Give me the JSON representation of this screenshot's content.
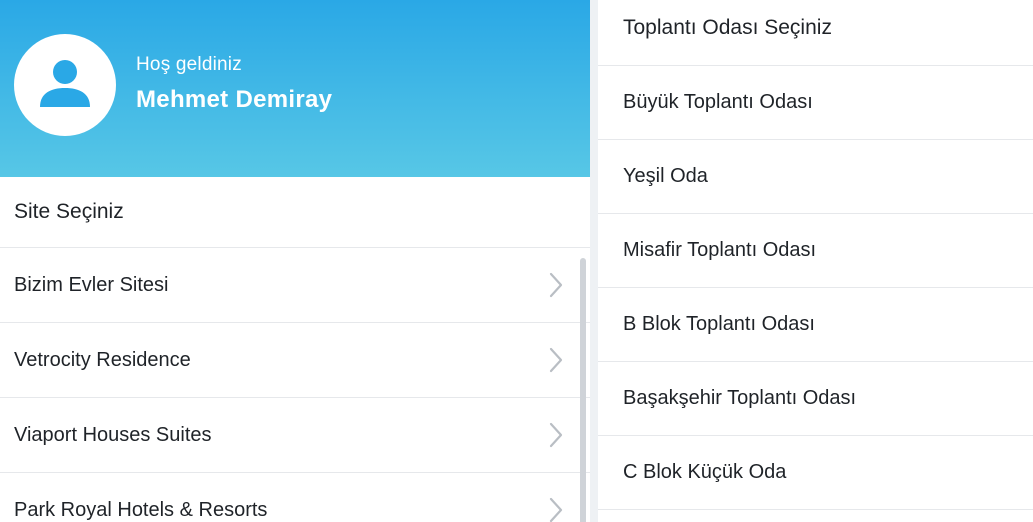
{
  "header": {
    "welcome": "Hoş geldiniz",
    "user_name": "Mehmet Demiray",
    "avatar_icon": "user-icon",
    "gradient_top": "#2aa8e6",
    "gradient_bottom": "#57c7e6"
  },
  "sites": {
    "title": "Site Seçiniz",
    "items": [
      {
        "label": "Bizim Evler Sitesi",
        "icon": "chevron-right-icon"
      },
      {
        "label": "Vetrocity Residence",
        "icon": "chevron-right-icon"
      },
      {
        "label": "Viaport Houses Suites",
        "icon": "chevron-right-icon"
      },
      {
        "label": "Park Royal Hotels & Resorts",
        "icon": "chevron-right-icon"
      }
    ]
  },
  "rooms": {
    "title": "Toplantı Odası Seçiniz",
    "items": [
      {
        "label": "Büyük Toplantı Odası"
      },
      {
        "label": "Yeşil Oda"
      },
      {
        "label": "Misafir Toplantı Odası"
      },
      {
        "label": "B Blok Toplantı Odası"
      },
      {
        "label": "Başakşehir Toplantı Odası"
      },
      {
        "label": "C Blok Küçük Oda"
      }
    ]
  }
}
